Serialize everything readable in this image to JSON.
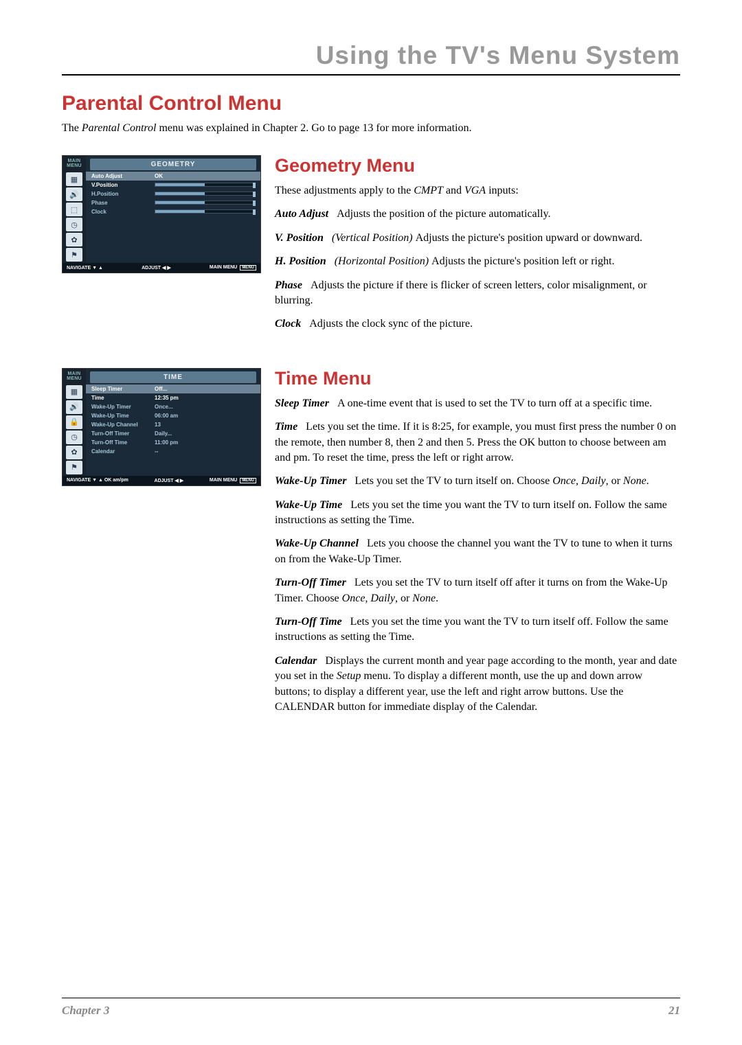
{
  "chapter_header": "Using the TV's Menu System",
  "section_parental": {
    "title": "Parental Control Menu",
    "intro_pre": "The ",
    "intro_em": "Parental Control",
    "intro_post": " menu was explained in Chapter 2. Go to page 13 for more information."
  },
  "section_geometry": {
    "title": "Geometry Menu",
    "intro_pre": "These adjustments apply to the ",
    "intro_em1": "CMPT",
    "intro_mid": " and ",
    "intro_em2": "VGA",
    "intro_post": " inputs:",
    "items": [
      {
        "term": "Auto Adjust",
        "desc": "Adjusts the position of the picture automatically."
      },
      {
        "term": "V. Position",
        "em": "(Vertical Position)",
        "desc": "Adjusts the picture's position upward or downward."
      },
      {
        "term": "H. Position",
        "em": "(Horizontal Position)",
        "desc": "Adjusts the picture's position left or right."
      },
      {
        "term": "Phase",
        "desc": "Adjusts the picture if there is flicker of screen letters, color misalignment, or blurring."
      },
      {
        "term": "Clock",
        "desc": "Adjusts the clock sync of the picture."
      }
    ]
  },
  "section_time": {
    "title": "Time Menu",
    "items": [
      {
        "term": "Sleep Timer",
        "desc": "A one-time event that is used to set the TV to turn off at a specific time."
      },
      {
        "term": "Time",
        "desc": "Lets you set the time. If it is 8:25, for example, you must first press the number 0 on the remote, then number 8, then 2 and then 5. Press the OK button to choose between am and pm. To reset the time, press the left or right arrow."
      },
      {
        "term": "Wake-Up Timer",
        "desc_pre": "Lets you set the TV to turn itself on. Choose ",
        "em": "Once, Daily",
        "desc_mid": ", or ",
        "em2": "None",
        "desc_post": "."
      },
      {
        "term": "Wake-Up Time",
        "desc": "Lets you set the time you want the TV to turn itself on. Follow the same instructions as setting the Time."
      },
      {
        "term": "Wake-Up Channel",
        "desc": "Lets you choose the channel you want the TV to tune to when it turns on from the Wake-Up Timer."
      },
      {
        "term": "Turn-Off Timer",
        "desc_pre": "Lets you set the TV to turn itself off after it turns on from the Wake-Up Timer. Choose ",
        "em": "Once, Daily",
        "desc_mid": ", or ",
        "em2": "None",
        "desc_post": "."
      },
      {
        "term": "Turn-Off Time",
        "desc": "Lets you set the time you want the TV to turn itself off. Follow the same instructions as setting the Time."
      },
      {
        "term": "Calendar",
        "desc_pre": "Displays the current month and year page according to the month, year and date you set in the ",
        "em": "Setup",
        "desc_post": " menu. To display a different month, use the up and down arrow buttons; to display a different year, use the left and right arrow buttons. Use the CALENDAR button for immediate display of the Calendar."
      }
    ]
  },
  "screenshot_geometry": {
    "sidebar_title": "MAIN MENU",
    "panel_title": "GEOMETRY",
    "rows": [
      {
        "label": "Auto Adjust",
        "value": "OK",
        "selected": true
      },
      {
        "label": "V.Position",
        "slider": true,
        "white": true
      },
      {
        "label": "H.Position",
        "slider": true
      },
      {
        "label": "Phase",
        "slider": true
      },
      {
        "label": "Clock",
        "slider": true
      }
    ],
    "footer_nav": "NAVIGATE ▼ ▲",
    "footer_adjust": "ADJUST  ◀ ▶",
    "footer_main": "MAIN MENU",
    "footer_menu": "MENU"
  },
  "screenshot_time": {
    "sidebar_title": "MAIN MENU",
    "panel_title": "TIME",
    "rows": [
      {
        "label": "Sleep Timer",
        "value": "Off...",
        "selected": true
      },
      {
        "label": "Time",
        "value": "12:35 pm",
        "white": true
      },
      {
        "label": "Wake-Up Timer",
        "value": "Once..."
      },
      {
        "label": "Wake-Up Time",
        "value": "06:00 am"
      },
      {
        "label": "Wake-Up Channel",
        "value": "13"
      },
      {
        "label": "Turn-Off Timer",
        "value": "Daily..."
      },
      {
        "label": "Turn-Off Time",
        "value": "11:00 pm"
      },
      {
        "label": "Calendar",
        "value": "--"
      }
    ],
    "footer_nav": "NAVIGATE ▼ ▲ OK am/pm",
    "footer_adjust": "ADJUST ◀ ▶",
    "footer_main": "MAIN MENU",
    "footer_menu": "MENU"
  },
  "footer": {
    "chapter": "Chapter 3",
    "page": "21"
  }
}
